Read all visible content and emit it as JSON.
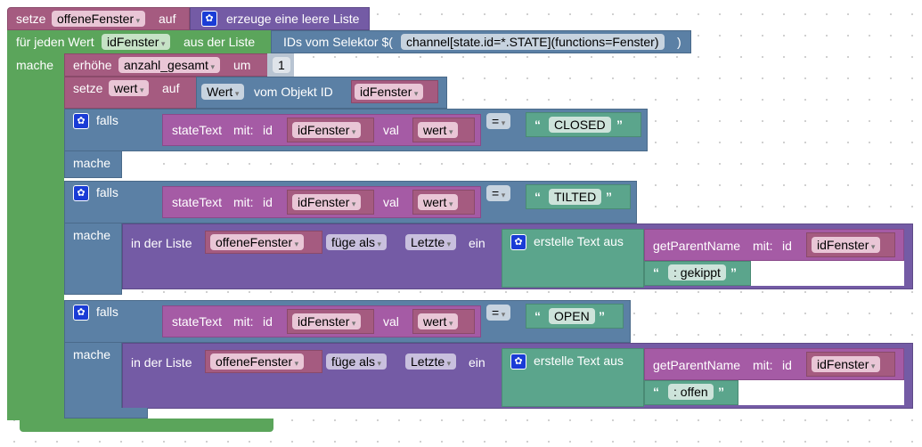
{
  "colors": {
    "variables": "#a55b80",
    "lists": "#745ba5",
    "loops": "#5ba55b",
    "logic": "#5b80a5",
    "custom": "#a55ba5",
    "text": "#5ba58c"
  },
  "row1": {
    "setze": "setze",
    "var": "offeneFenster",
    "auf": "auf",
    "list": "erzeuge eine leere Liste"
  },
  "loop": {
    "label": "für jeden Wert",
    "var": "idFenster",
    "from": "aus der Liste",
    "selector": "IDs vom Selektor $(",
    "selector_value": "channel[state.id=*.STATE](functions=Fenster)",
    "close": ")",
    "mache": "mache"
  },
  "inc": {
    "label": "erhöhe",
    "var": "anzahl_gesamt",
    "um": "um",
    "value": "1"
  },
  "set2": {
    "setze": "setze",
    "var": "wert",
    "auf": "auf",
    "prop": "Wert",
    "from": "vom Objekt ID",
    "id": "idFenster"
  },
  "if_blocks": [
    {
      "falls": "falls",
      "mache": "mache",
      "fn": "stateText",
      "mit": "mit:",
      "id_label": "id",
      "id": "idFenster",
      "val_label": "val",
      "val": "wert",
      "op": "=",
      "text": "CLOSED"
    },
    {
      "falls": "falls",
      "mache": "mache",
      "fn": "stateText",
      "mit": "mit:",
      "id_label": "id",
      "id": "idFenster",
      "val_label": "val",
      "val": "wert",
      "op": "=",
      "text": "TILTED",
      "action": {
        "in": "in der Liste",
        "list": "offeneFenster",
        "insert": "füge als",
        "pos": "Letzte",
        "ein": "ein",
        "join": "erstelle Text aus",
        "fn": "getParentName",
        "mit": "mit:",
        "id_label": "id",
        "id": "idFenster",
        "suffix": ": gekippt"
      }
    },
    {
      "falls": "falls",
      "mache": "mache",
      "fn": "stateText",
      "mit": "mit:",
      "id_label": "id",
      "id": "idFenster",
      "val_label": "val",
      "val": "wert",
      "op": "=",
      "text": "OPEN",
      "action": {
        "in": "in der Liste",
        "list": "offeneFenster",
        "insert": "füge als",
        "pos": "Letzte",
        "ein": "ein",
        "join": "erstelle Text aus",
        "fn": "getParentName",
        "mit": "mit:",
        "id_label": "id",
        "id": "idFenster",
        "suffix": ": offen"
      }
    }
  ]
}
